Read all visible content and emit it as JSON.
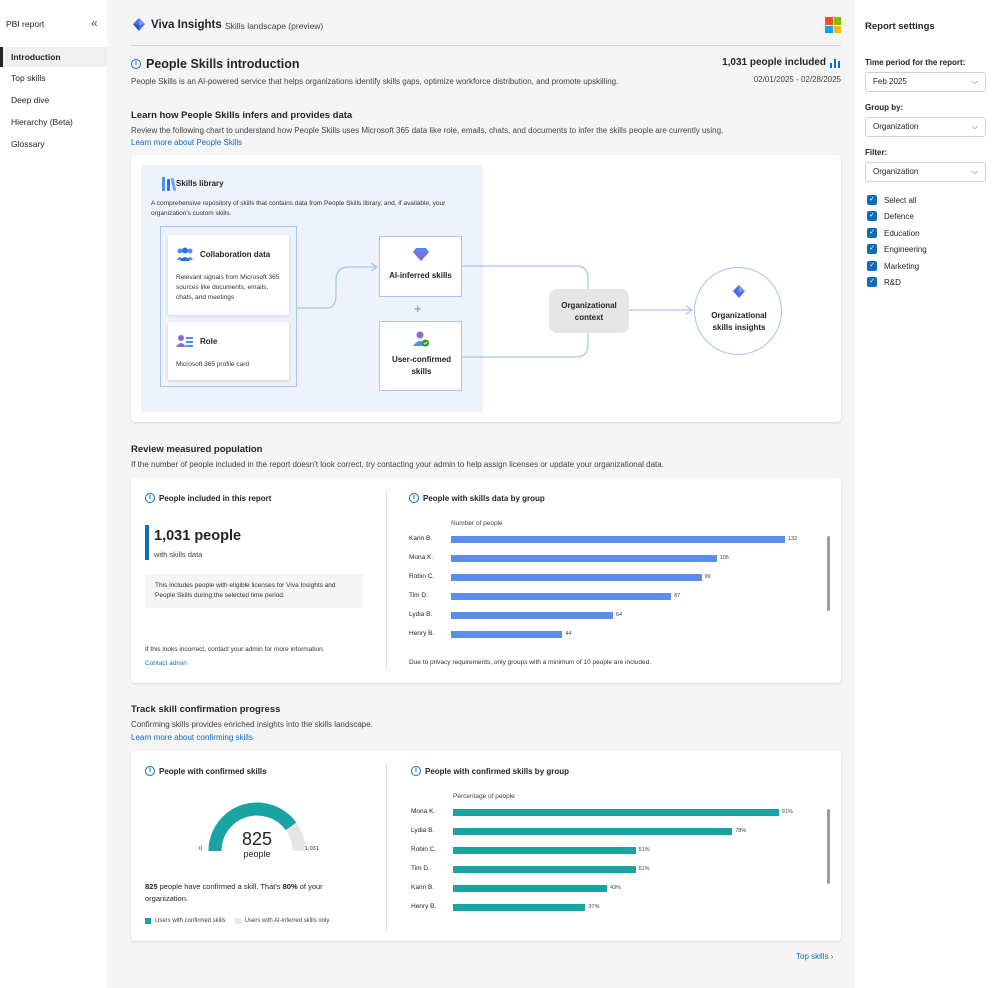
{
  "colors": {
    "accent": "#0f6cbd",
    "bar_blue": "#5b8def",
    "bar_teal": "#1aa3a3",
    "gauge_track": "#e6e6e6"
  },
  "leftnav": {
    "header": "PBI report",
    "items": [
      {
        "label": "Introduction"
      },
      {
        "label": "Top skills"
      },
      {
        "label": "Deep dive"
      },
      {
        "label": "Hierarchy (Beta)"
      },
      {
        "label": "Glossary"
      }
    ]
  },
  "header": {
    "brand": "Viva Insights",
    "subtitle": "Skills landscape (preview)"
  },
  "intro": {
    "title": "People Skills introduction",
    "description": "People Skills is an AI-powered service that helps organizations identify skills gaps, optimize workforce distribution, and promote upskilling.",
    "people_included": "1,031 people included",
    "date_range": "02/01/2025 - 02/28/2025"
  },
  "infer_section": {
    "title": "Learn how People Skills infers and provides data",
    "description": "Review the following chart to understand how People Skills uses Microsoft 365 data like role, emails, chats, and documents to infer the skills people are currently using.",
    "link": "Learn more about People Skills"
  },
  "diagram": {
    "library_title": "Skills library",
    "library_desc": "A comprehensive repository of skills that contains data from People Skills library, and, if available, your organization's custom skills.",
    "collab_title": "Collaboration data",
    "collab_desc": "Relevant signals from Microsoft 365 sources like documents, emails, chats, and meetings",
    "role_title": "Role",
    "role_desc": "Microsoft 365 profile card",
    "ai_inferred": "AI-inferred skills",
    "plus": "+",
    "user_confirmed": "User-confirmed skills",
    "org_context": "Organizational context",
    "org_insights": "Organizational skills insights"
  },
  "population": {
    "title": "Review measured population",
    "description": "If the number of people included in the report doesn't look correct, try contacting your admin to help assign licenses or update your organizational data.",
    "left_title": "People included in this report",
    "big_number": "1,031 people",
    "big_sub": "with skills data",
    "note": "This includes people with eligible licenses for Viva Insights and People Skills during the selected time period.",
    "incorrect": "If this looks incorrect, contact your admin for more information.",
    "contact": "Contact admin",
    "right_title": "People with skills data by group",
    "axis_label": "Number of people",
    "footnote": "Due to privacy requirements, only groups with a minimum of 10 people are included."
  },
  "chart_data": [
    {
      "type": "bar",
      "orientation": "horizontal",
      "title": "People with skills data by group",
      "xlabel": "Number of people",
      "categories": [
        "Karin B.",
        "Mona K.",
        "Robin C.",
        "Tim D.",
        "Lydia B.",
        "Henry B."
      ],
      "values": [
        132,
        105,
        99,
        87,
        64,
        44
      ],
      "value_labels": [
        "132",
        "105",
        "99",
        "87",
        "64",
        "44"
      ]
    },
    {
      "type": "bar",
      "orientation": "horizontal",
      "title": "People with confirmed skills by group",
      "xlabel": "Percentage of people",
      "categories": [
        "Mona K.",
        "Lydia B.",
        "Robin C.",
        "Tim D.",
        "Karin B.",
        "Henry B."
      ],
      "values": [
        91,
        78,
        51,
        51,
        43,
        37
      ],
      "value_labels": [
        "91%",
        "78%",
        "51%",
        "51%",
        "43%",
        "37%"
      ]
    },
    {
      "type": "gauge",
      "title": "People with confirmed skills",
      "value": 825,
      "min": 0,
      "max": 1031,
      "min_label": "0",
      "max_label": "1,031",
      "value_label": "825",
      "unit_label": "people",
      "legend": [
        "Users with confirmed skills",
        "Users with AI-inferred skills only"
      ]
    }
  ],
  "confirmation": {
    "title": "Track skill confirmation progress",
    "description": "Confirming skills provides enriched insights into the skills landscape.",
    "link": "Learn more about confirming skills",
    "left_title": "People with confirmed skills",
    "summary_num": "825",
    "summary_text_a": " people have confirmed a skill. That's ",
    "summary_pct": "80%",
    "summary_text_b": " of your organization.",
    "right_title": "People with confirmed skills by group",
    "axis_label": "Percentage of people"
  },
  "footer": {
    "next_link": "Top skills"
  },
  "settings": {
    "title": "Report settings",
    "time_label": "Time period for the report:",
    "time_value": "Feb 2025",
    "group_label": "Group by:",
    "group_value": "Organization",
    "filter_label": "Filter:",
    "filter_value": "Organization",
    "filter_options": [
      "Select all",
      "Defence",
      "Education",
      "Engineering",
      "Marketing",
      "R&D"
    ]
  }
}
